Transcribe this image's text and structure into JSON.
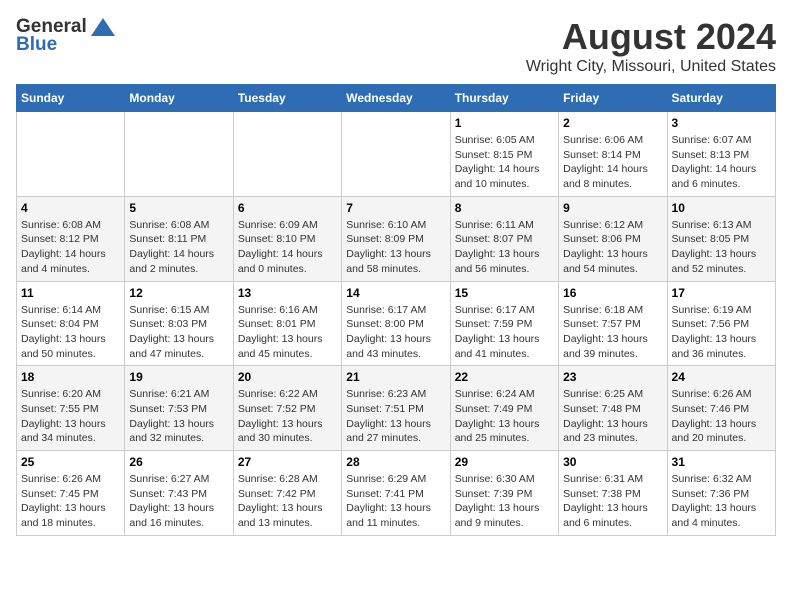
{
  "header": {
    "logo_general": "General",
    "logo_blue": "Blue",
    "month_title": "August 2024",
    "location": "Wright City, Missouri, United States"
  },
  "days_of_week": [
    "Sunday",
    "Monday",
    "Tuesday",
    "Wednesday",
    "Thursday",
    "Friday",
    "Saturday"
  ],
  "weeks": [
    [
      {
        "day": "",
        "info": ""
      },
      {
        "day": "",
        "info": ""
      },
      {
        "day": "",
        "info": ""
      },
      {
        "day": "",
        "info": ""
      },
      {
        "day": "1",
        "info": "Sunrise: 6:05 AM\nSunset: 8:15 PM\nDaylight: 14 hours\nand 10 minutes."
      },
      {
        "day": "2",
        "info": "Sunrise: 6:06 AM\nSunset: 8:14 PM\nDaylight: 14 hours\nand 8 minutes."
      },
      {
        "day": "3",
        "info": "Sunrise: 6:07 AM\nSunset: 8:13 PM\nDaylight: 14 hours\nand 6 minutes."
      }
    ],
    [
      {
        "day": "4",
        "info": "Sunrise: 6:08 AM\nSunset: 8:12 PM\nDaylight: 14 hours\nand 4 minutes."
      },
      {
        "day": "5",
        "info": "Sunrise: 6:08 AM\nSunset: 8:11 PM\nDaylight: 14 hours\nand 2 minutes."
      },
      {
        "day": "6",
        "info": "Sunrise: 6:09 AM\nSunset: 8:10 PM\nDaylight: 14 hours\nand 0 minutes."
      },
      {
        "day": "7",
        "info": "Sunrise: 6:10 AM\nSunset: 8:09 PM\nDaylight: 13 hours\nand 58 minutes."
      },
      {
        "day": "8",
        "info": "Sunrise: 6:11 AM\nSunset: 8:07 PM\nDaylight: 13 hours\nand 56 minutes."
      },
      {
        "day": "9",
        "info": "Sunrise: 6:12 AM\nSunset: 8:06 PM\nDaylight: 13 hours\nand 54 minutes."
      },
      {
        "day": "10",
        "info": "Sunrise: 6:13 AM\nSunset: 8:05 PM\nDaylight: 13 hours\nand 52 minutes."
      }
    ],
    [
      {
        "day": "11",
        "info": "Sunrise: 6:14 AM\nSunset: 8:04 PM\nDaylight: 13 hours\nand 50 minutes."
      },
      {
        "day": "12",
        "info": "Sunrise: 6:15 AM\nSunset: 8:03 PM\nDaylight: 13 hours\nand 47 minutes."
      },
      {
        "day": "13",
        "info": "Sunrise: 6:16 AM\nSunset: 8:01 PM\nDaylight: 13 hours\nand 45 minutes."
      },
      {
        "day": "14",
        "info": "Sunrise: 6:17 AM\nSunset: 8:00 PM\nDaylight: 13 hours\nand 43 minutes."
      },
      {
        "day": "15",
        "info": "Sunrise: 6:17 AM\nSunset: 7:59 PM\nDaylight: 13 hours\nand 41 minutes."
      },
      {
        "day": "16",
        "info": "Sunrise: 6:18 AM\nSunset: 7:57 PM\nDaylight: 13 hours\nand 39 minutes."
      },
      {
        "day": "17",
        "info": "Sunrise: 6:19 AM\nSunset: 7:56 PM\nDaylight: 13 hours\nand 36 minutes."
      }
    ],
    [
      {
        "day": "18",
        "info": "Sunrise: 6:20 AM\nSunset: 7:55 PM\nDaylight: 13 hours\nand 34 minutes."
      },
      {
        "day": "19",
        "info": "Sunrise: 6:21 AM\nSunset: 7:53 PM\nDaylight: 13 hours\nand 32 minutes."
      },
      {
        "day": "20",
        "info": "Sunrise: 6:22 AM\nSunset: 7:52 PM\nDaylight: 13 hours\nand 30 minutes."
      },
      {
        "day": "21",
        "info": "Sunrise: 6:23 AM\nSunset: 7:51 PM\nDaylight: 13 hours\nand 27 minutes."
      },
      {
        "day": "22",
        "info": "Sunrise: 6:24 AM\nSunset: 7:49 PM\nDaylight: 13 hours\nand 25 minutes."
      },
      {
        "day": "23",
        "info": "Sunrise: 6:25 AM\nSunset: 7:48 PM\nDaylight: 13 hours\nand 23 minutes."
      },
      {
        "day": "24",
        "info": "Sunrise: 6:26 AM\nSunset: 7:46 PM\nDaylight: 13 hours\nand 20 minutes."
      }
    ],
    [
      {
        "day": "25",
        "info": "Sunrise: 6:26 AM\nSunset: 7:45 PM\nDaylight: 13 hours\nand 18 minutes."
      },
      {
        "day": "26",
        "info": "Sunrise: 6:27 AM\nSunset: 7:43 PM\nDaylight: 13 hours\nand 16 minutes."
      },
      {
        "day": "27",
        "info": "Sunrise: 6:28 AM\nSunset: 7:42 PM\nDaylight: 13 hours\nand 13 minutes."
      },
      {
        "day": "28",
        "info": "Sunrise: 6:29 AM\nSunset: 7:41 PM\nDaylight: 13 hours\nand 11 minutes."
      },
      {
        "day": "29",
        "info": "Sunrise: 6:30 AM\nSunset: 7:39 PM\nDaylight: 13 hours\nand 9 minutes."
      },
      {
        "day": "30",
        "info": "Sunrise: 6:31 AM\nSunset: 7:38 PM\nDaylight: 13 hours\nand 6 minutes."
      },
      {
        "day": "31",
        "info": "Sunrise: 6:32 AM\nSunset: 7:36 PM\nDaylight: 13 hours\nand 4 minutes."
      }
    ]
  ]
}
